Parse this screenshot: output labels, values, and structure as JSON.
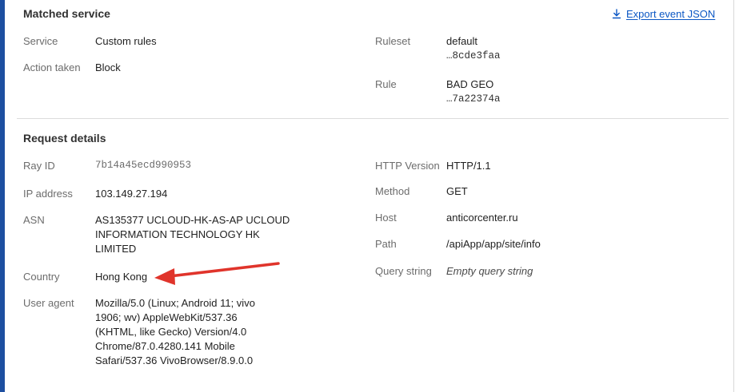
{
  "matched_service": {
    "title": "Matched service",
    "export_label": "Export event JSON",
    "service_label": "Service",
    "service_value": "Custom rules",
    "action_label": "Action taken",
    "action_value": "Block",
    "ruleset_label": "Ruleset",
    "ruleset_name": "default",
    "ruleset_id": "…8cde3faa",
    "rule_label": "Rule",
    "rule_name": "BAD GEO",
    "rule_id": "…7a22374a"
  },
  "request_details": {
    "title": "Request details",
    "ray_id_label": "Ray ID",
    "ray_id_value": "7b14a45ecd990953",
    "ip_label": "IP address",
    "ip_value": "103.149.27.194",
    "asn_label": "ASN",
    "asn_value": "AS135377 UCLOUD-HK-AS-AP UCLOUD INFORMATION TECHNOLOGY HK LIMITED",
    "country_label": "Country",
    "country_value": "Hong Kong",
    "user_agent_label": "User agent",
    "user_agent_value": "Mozilla/5.0 (Linux; Android 11; vivo 1906; wv) AppleWebKit/537.36 (KHTML, like Gecko) Version/4.0 Chrome/87.0.4280.141 Mobile Safari/537.36 VivoBrowser/8.9.0.0",
    "http_version_label": "HTTP Version",
    "http_version_value": "HTTP/1.1",
    "method_label": "Method",
    "method_value": "GET",
    "host_label": "Host",
    "host_value": "anticorcenter.ru",
    "path_label": "Path",
    "path_value": "/apiApp/app/site/info",
    "query_label": "Query string",
    "query_value": "Empty query string"
  },
  "annotation": {
    "arrow_color": "#e0342b"
  },
  "icons": {
    "export": "download-icon"
  },
  "colors": {
    "accent_bar": "#1d4fa0",
    "link": "#0b57c4"
  }
}
